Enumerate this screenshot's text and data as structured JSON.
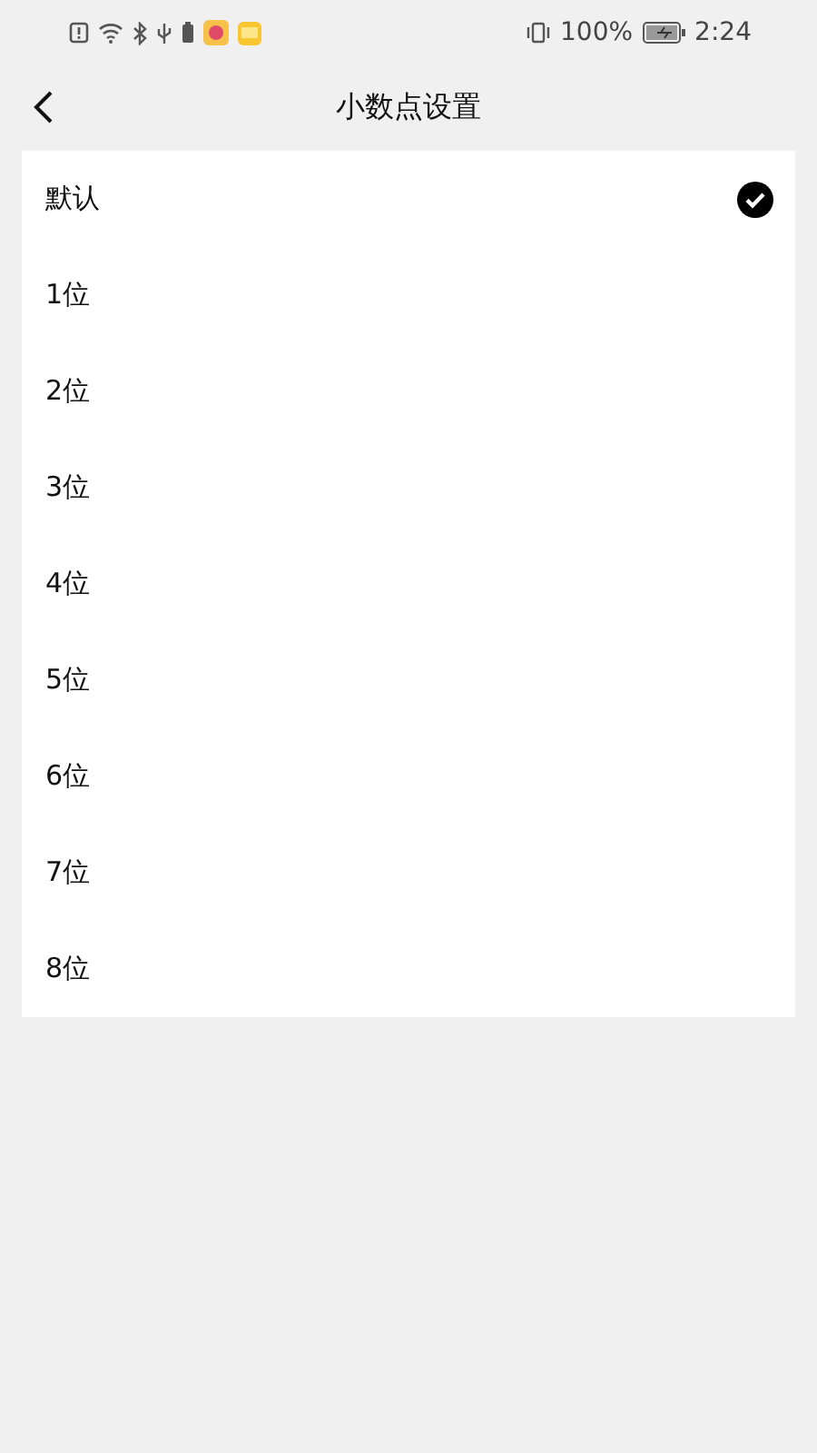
{
  "status_bar": {
    "battery": "100%",
    "time": "2:24"
  },
  "header": {
    "title": "小数点设置"
  },
  "options": [
    {
      "label": "默认",
      "selected": true
    },
    {
      "label": "1位",
      "selected": false
    },
    {
      "label": "2位",
      "selected": false
    },
    {
      "label": "3位",
      "selected": false
    },
    {
      "label": "4位",
      "selected": false
    },
    {
      "label": "5位",
      "selected": false
    },
    {
      "label": "6位",
      "selected": false
    },
    {
      "label": "7位",
      "selected": false
    },
    {
      "label": "8位",
      "selected": false
    }
  ]
}
